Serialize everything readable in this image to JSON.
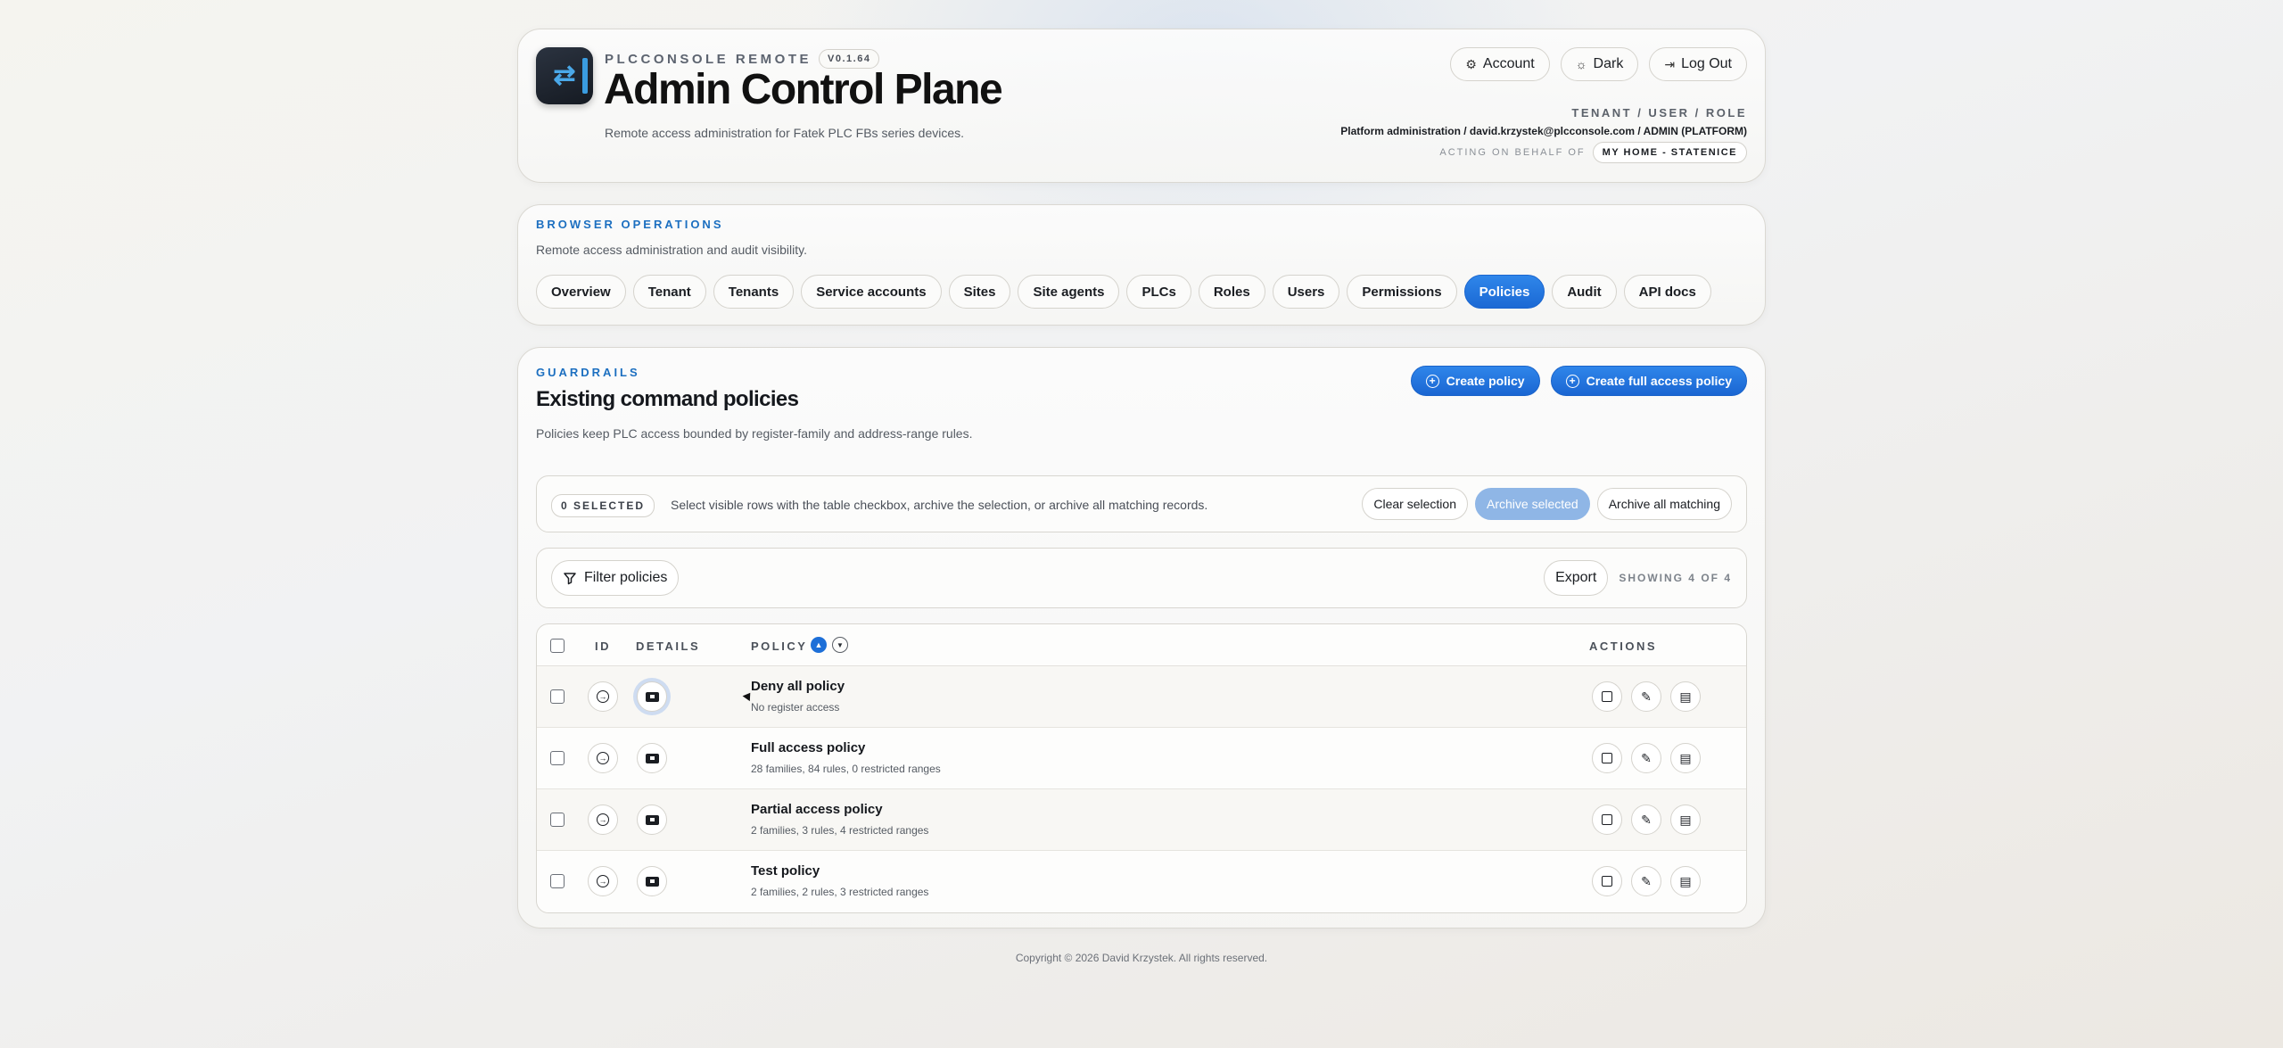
{
  "header": {
    "brand": "PLCCONSOLE REMOTE",
    "version": "V0.1.64",
    "title": "Admin Control Plane",
    "subtitle": "Remote access administration for Fatek PLC FBs series devices.",
    "buttons": {
      "account": "Account",
      "theme": "Dark",
      "logout": "Log Out"
    },
    "meta_label": "TENANT / USER / ROLE",
    "meta_user": "Platform administration / david.krzystek@plcconsole.com / ADMIN (PLATFORM)",
    "behalf_label": "ACTING ON BEHALF OF",
    "behalf_value": "MY HOME - STATENICE"
  },
  "ops": {
    "kicker": "BROWSER OPERATIONS",
    "desc": "Remote access administration and audit visibility.",
    "tabs": [
      "Overview",
      "Tenant",
      "Tenants",
      "Service accounts",
      "Sites",
      "Site agents",
      "PLCs",
      "Roles",
      "Users",
      "Permissions",
      "Policies",
      "Audit",
      "API docs"
    ],
    "active_tab": "Policies"
  },
  "guard": {
    "kicker": "GUARDRAILS",
    "title": "Existing command policies",
    "desc": "Policies keep PLC access bounded by register-family and address-range rules.",
    "create_policy": "Create policy",
    "create_full": "Create full access policy",
    "selected": "0 SELECTED",
    "sel_help": "Select visible rows with the table checkbox, archive the selection, or archive all matching records.",
    "clear_selection": "Clear selection",
    "archive_selected": "Archive selected",
    "archive_all": "Archive all matching",
    "filter": "Filter policies",
    "export": "Export",
    "showing": "SHOWING 4 OF 4",
    "columns": {
      "id": "ID",
      "details": "DETAILS",
      "policy": "POLICY",
      "actions": "ACTIONS"
    },
    "rows": [
      {
        "name": "Deny all policy",
        "summary": "No register access"
      },
      {
        "name": "Full access policy",
        "summary": "28 families, 84 rules, 0 restricted ranges"
      },
      {
        "name": "Partial access policy",
        "summary": "2 families, 3 rules, 4 restricted ranges"
      },
      {
        "name": "Test policy",
        "summary": "2 families, 2 rules, 3 restricted ranges"
      }
    ]
  },
  "footer": "Copyright © 2026 David Krzystek. All rights reserved.",
  "colors": {
    "accent": "#1b69d4",
    "kicker": "#1c6fc0"
  }
}
